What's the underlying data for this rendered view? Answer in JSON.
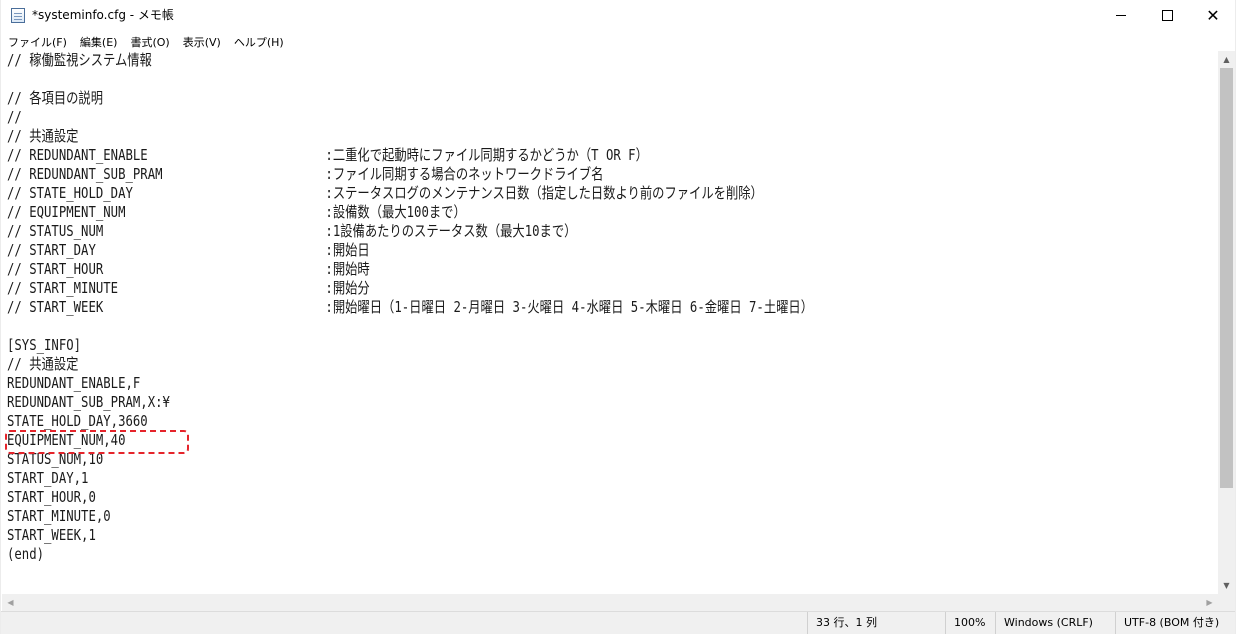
{
  "window": {
    "title": "*systeminfo.cfg - メモ帳",
    "minimize_glyph": "minimize-icon",
    "maximize_glyph": "maximize-icon",
    "close_glyph": "✕"
  },
  "menu": [
    {
      "label": "ファイル(F)"
    },
    {
      "label": "編集(E)"
    },
    {
      "label": "書式(O)"
    },
    {
      "label": "表示(V)"
    },
    {
      "label": "ヘルプ(H)"
    }
  ],
  "editor": {
    "lines": [
      "// 稼働監視システム情報",
      "",
      "// 各項目の説明",
      "//",
      "// 共通設定",
      "// REDUNDANT_ENABLE                        :二重化で起動時にファイル同期するかどうか（T OR F）",
      "// REDUNDANT_SUB_PRAM                      :ファイル同期する場合のネットワークドライブ名",
      "// STATE_HOLD_DAY                          :ステータスログのメンテナンス日数（指定した日数より前のファイルを削除）",
      "// EQUIPMENT_NUM                           :設備数（最大100まで）",
      "// STATUS_NUM                              :1設備あたりのステータス数（最大10まで）",
      "// START_DAY                               :開始日",
      "// START_HOUR                              :開始時",
      "// START_MINUTE                            :開始分",
      "// START_WEEK                              :開始曜日（1-日曜日 2-月曜日 3-火曜日 4-水曜日 5-木曜日 6-金曜日 7-土曜日）",
      "",
      "[SYS_INFO]",
      "// 共通設定",
      "REDUNDANT_ENABLE,F",
      "REDUNDANT_SUB_PRAM,X:¥",
      "STATE_HOLD_DAY,3660",
      "EQUIPMENT_NUM,40",
      "STATUS_NUM,10",
      "START_DAY,1",
      "START_HOUR,0",
      "START_MINUTE,0",
      "START_WEEK,1",
      "(end)"
    ],
    "highlighted_line": "EQUIPMENT_NUM,40"
  },
  "scrollbars": {
    "up_arrow": "▲",
    "down_arrow": "▼",
    "left_arrow": "◀",
    "right_arrow": "▶"
  },
  "status": {
    "position": "33 行、1 列",
    "zoom": "100%",
    "line_ending": "Windows (CRLF)",
    "encoding": "UTF-8 (BOM 付き)"
  },
  "colors": {
    "highlight_border": "#e5242b",
    "scroll_thumb": "#c2c2c2",
    "statusbar_bg": "#f0f0f0"
  }
}
